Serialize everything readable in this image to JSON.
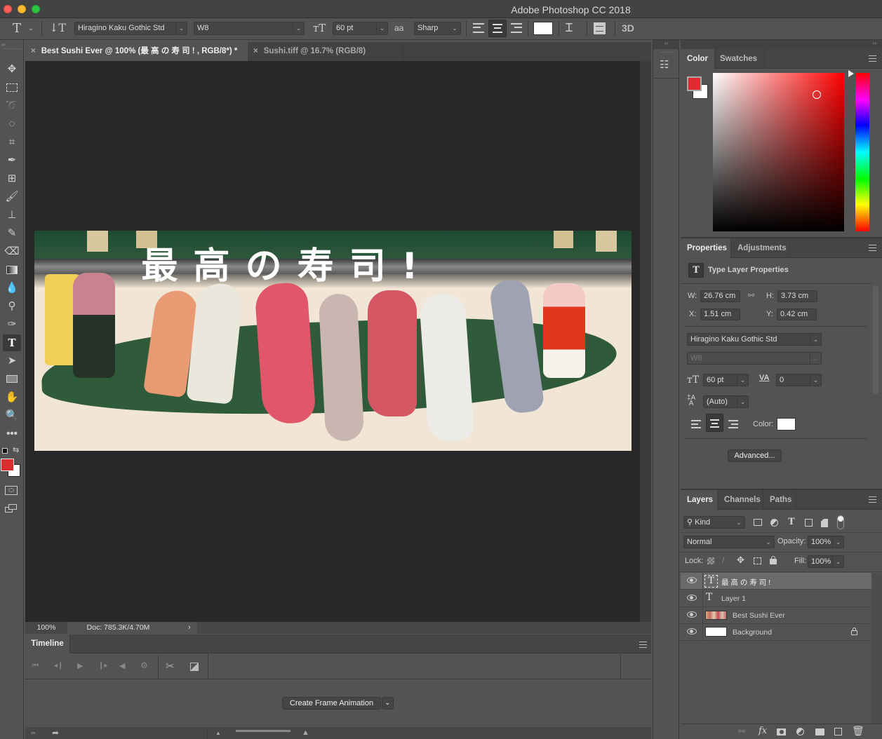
{
  "window": {
    "title": "Adobe Photoshop CC 2018"
  },
  "options_bar": {
    "font_family": "Hiragino Kaku Gothic Std",
    "font_style": "W8",
    "font_size": "60 pt",
    "antialias_label": "aa",
    "antialias": "Sharp",
    "three_d_label": "3D",
    "text_color": "#ffffff"
  },
  "tabs": [
    {
      "label": "Best Sushi Ever @ 100% (最 高 の 寿 司 ! , RGB/8*) *",
      "active": true
    },
    {
      "label": "Sushi.tiff @ 16.7% (RGB/8)",
      "active": false
    }
  ],
  "canvas": {
    "overlay_text": "最 高 の 寿 司 !"
  },
  "status_bar": {
    "zoom": "100%",
    "doc_info": "Doc: 785.3K/4.70M",
    "arrow": "›"
  },
  "tools": {
    "foreground_color": "#dd2c2f",
    "background_color": "#ffffff",
    "items": [
      "move",
      "marquee",
      "lasso",
      "quick-select",
      "crop",
      "eyedropper",
      "healing",
      "brush",
      "stamp",
      "history-brush",
      "eraser",
      "gradient",
      "blur",
      "dodge",
      "pen",
      "type",
      "path-select",
      "rectangle",
      "hand",
      "zoom",
      "more"
    ]
  },
  "timeline": {
    "title": "Timeline",
    "create_button": "Create Frame Animation"
  },
  "color_panel": {
    "tabs": [
      "Color",
      "Swatches"
    ],
    "foreground": "#dd2c2f",
    "background": "#ffffff",
    "hue_color": "#ff0000"
  },
  "properties": {
    "tabs": [
      "Properties",
      "Adjustments"
    ],
    "header": "Type Layer Properties",
    "w_label": "W:",
    "w": "26.76 cm",
    "h_label": "H:",
    "h": "3.73 cm",
    "x_label": "X:",
    "x": "1.51 cm",
    "y_label": "Y:",
    "y": "0.42 cm",
    "font_family": "Hiragino Kaku Gothic Std",
    "font_style": "W8",
    "font_size": "60 pt",
    "tracking": "0",
    "leading": "(Auto)",
    "color_label": "Color:",
    "advanced_button": "Advanced..."
  },
  "layers": {
    "tabs": [
      "Layers",
      "Channels",
      "Paths"
    ],
    "filter_kind": "Kind",
    "blend_mode": "Normal",
    "opacity_label": "Opacity:",
    "opacity": "100%",
    "lock_label": "Lock:",
    "fill_label": "Fill:",
    "fill": "100%",
    "items": [
      {
        "name": "最 高 の 寿 司 !",
        "type": "text",
        "selected": true,
        "visible": true
      },
      {
        "name": "Layer 1",
        "type": "text",
        "selected": false,
        "visible": true
      },
      {
        "name": "Best Sushi Ever",
        "type": "image",
        "selected": false,
        "visible": true
      },
      {
        "name": "Background",
        "type": "background",
        "selected": false,
        "visible": true,
        "locked": true
      }
    ]
  }
}
